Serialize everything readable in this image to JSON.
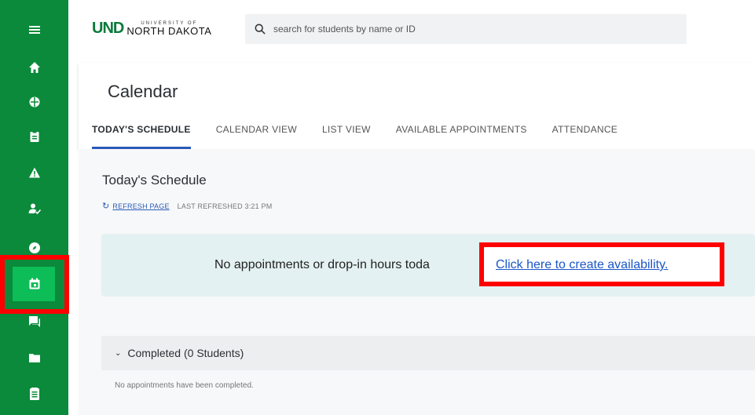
{
  "logo": {
    "und": "UND",
    "university": "UNIVERSITY OF",
    "name": "NORTH DAKOTA"
  },
  "search": {
    "placeholder": "search for students by name or ID"
  },
  "sidebar": {
    "items": [
      {
        "icon": "menu-icon"
      },
      {
        "icon": "home-icon"
      },
      {
        "icon": "globe-icon"
      },
      {
        "icon": "clipboard-icon"
      },
      {
        "icon": "alert-icon"
      },
      {
        "icon": "user-check-icon"
      },
      {
        "icon": "compass-icon"
      },
      {
        "icon": "calendar-icon",
        "active": true
      },
      {
        "icon": "chat-icon"
      },
      {
        "icon": "folder-icon"
      },
      {
        "icon": "contact-card-icon"
      }
    ],
    "active_color": "#0dbd57",
    "bg_color": "#0a8a3a"
  },
  "page": {
    "title": "Calendar",
    "tabs": [
      {
        "label": "TODAY'S SCHEDULE",
        "active": true
      },
      {
        "label": "CALENDAR VIEW"
      },
      {
        "label": "LIST VIEW"
      },
      {
        "label": "AVAILABLE APPOINTMENTS"
      },
      {
        "label": "ATTENDANCE"
      }
    ]
  },
  "schedule": {
    "title": "Today's Schedule",
    "refresh_label": "REFRESH PAGE",
    "last_refreshed": "LAST REFRESHED 3:21 PM",
    "empty_message": "No appointments or drop-in hours toda",
    "create_link": "Click here to create availability."
  },
  "completed": {
    "label": "Completed (0 Students)",
    "empty_message": "No appointments have been completed."
  },
  "colors": {
    "highlight": "#ff0000",
    "link": "#1a56c9",
    "tab_underline": "#2a5ab8"
  }
}
